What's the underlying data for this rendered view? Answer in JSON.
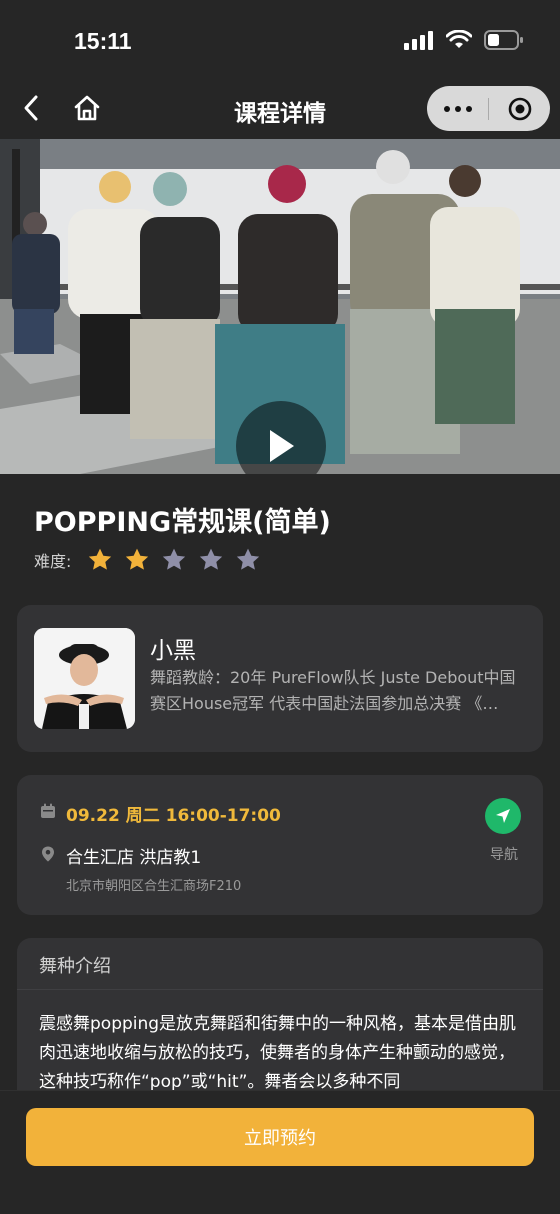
{
  "status_bar": {
    "time": "15:11",
    "icons": [
      "signal-icon",
      "wifi-icon",
      "battery-icon"
    ]
  },
  "nav": {
    "title": "课程详情",
    "back_icon": "chevron-left-icon",
    "home_icon": "home-icon",
    "capsule_icons": [
      "more-icon",
      "close-target-icon"
    ]
  },
  "video": {
    "play_icon": "play-icon"
  },
  "course": {
    "title": "POPPING常规课(简单)",
    "difficulty_label": "难度:",
    "difficulty_rating": 2,
    "difficulty_max": 5
  },
  "teacher": {
    "name": "小黑",
    "bio": "舞蹈教龄：20年 PureFlow队长 Juste Debout中国赛区House冠军 代表中国赴法国参加总决赛 《…"
  },
  "schedule": {
    "time": "09.22 周二 16:00-17:00",
    "venue": "合生汇店 洪店教1",
    "address": "北京市朝阳区合生汇商场F210",
    "nav_label": "导航"
  },
  "intro": {
    "title": "舞种介绍",
    "body": "震感舞popping是放克舞蹈和街舞中的一种风格，基本是借由肌肉迅速地收缩与放松的技巧，使舞者的身体产生种颤动的感觉，这种技巧称作“pop”或“hit”。舞者会以多种不同"
  },
  "footer": {
    "book_label": "立即预约"
  },
  "colors": {
    "background": "#262626",
    "card": "#333335",
    "accent": "#f2b23a",
    "time_text": "#f0b93b",
    "star_filled": "#f2b23a",
    "star_empty": "#8f8fa8",
    "nav_green": "#1fb86a"
  }
}
